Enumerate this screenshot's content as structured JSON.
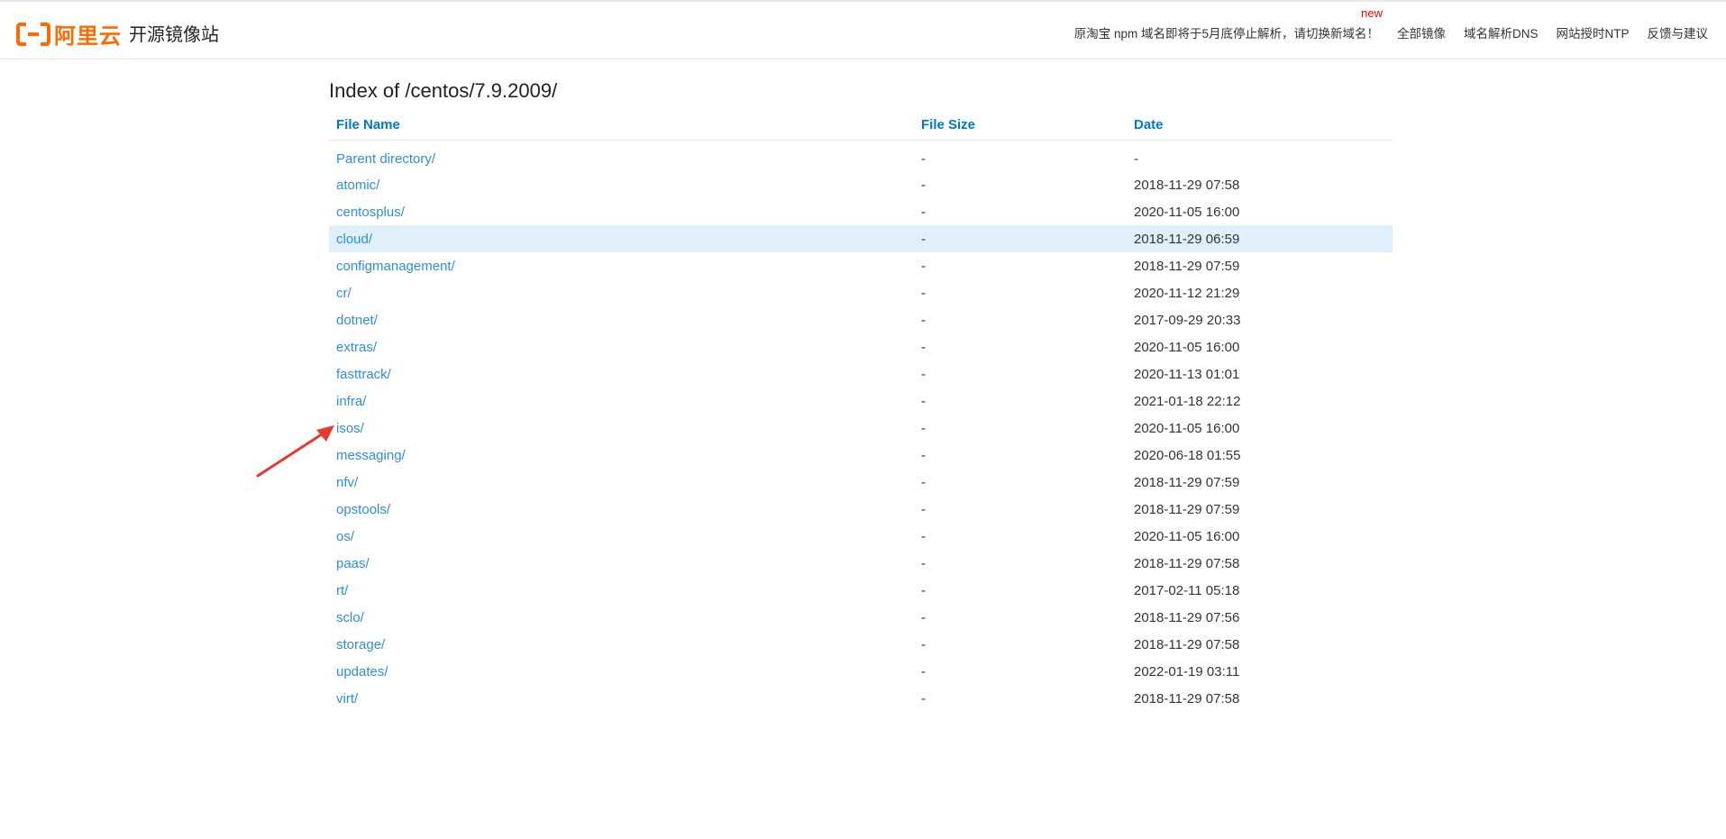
{
  "header": {
    "logo_text": "阿里云",
    "site_title": "开源镜像站",
    "notice": "原淘宝 npm 域名即将于5月底停止解析，请切换新域名！",
    "new_badge": "new",
    "nav": [
      "全部镜像",
      "域名解析DNS",
      "网站授时NTP",
      "反馈与建议"
    ],
    "brand_color": "#ff6a00"
  },
  "page_title": "Index of /centos/7.9.2009/",
  "table": {
    "columns": [
      "File Name",
      "File Size",
      "Date"
    ],
    "rows": [
      {
        "name": "Parent directory/",
        "size": "-",
        "date": "-"
      },
      {
        "name": "atomic/",
        "size": "-",
        "date": "2018-11-29 07:58"
      },
      {
        "name": "centosplus/",
        "size": "-",
        "date": "2020-11-05 16:00"
      },
      {
        "name": "cloud/",
        "size": "-",
        "date": "2018-11-29 06:59"
      },
      {
        "name": "configmanagement/",
        "size": "-",
        "date": "2018-11-29 07:59"
      },
      {
        "name": "cr/",
        "size": "-",
        "date": "2020-11-12 21:29"
      },
      {
        "name": "dotnet/",
        "size": "-",
        "date": "2017-09-29 20:33"
      },
      {
        "name": "extras/",
        "size": "-",
        "date": "2020-11-05 16:00"
      },
      {
        "name": "fasttrack/",
        "size": "-",
        "date": "2020-11-13 01:01"
      },
      {
        "name": "infra/",
        "size": "-",
        "date": "2021-01-18 22:12"
      },
      {
        "name": "isos/",
        "size": "-",
        "date": "2020-11-05 16:00"
      },
      {
        "name": "messaging/",
        "size": "-",
        "date": "2020-06-18 01:55"
      },
      {
        "name": "nfv/",
        "size": "-",
        "date": "2018-11-29 07:59"
      },
      {
        "name": "opstools/",
        "size": "-",
        "date": "2018-11-29 07:59"
      },
      {
        "name": "os/",
        "size": "-",
        "date": "2020-11-05 16:00"
      },
      {
        "name": "paas/",
        "size": "-",
        "date": "2018-11-29 07:58"
      },
      {
        "name": "rt/",
        "size": "-",
        "date": "2017-02-11 05:18"
      },
      {
        "name": "sclo/",
        "size": "-",
        "date": "2018-11-29 07:56"
      },
      {
        "name": "storage/",
        "size": "-",
        "date": "2018-11-29 07:58"
      },
      {
        "name": "updates/",
        "size": "-",
        "date": "2022-01-19 03:11"
      },
      {
        "name": "virt/",
        "size": "-",
        "date": "2018-11-29 07:58"
      }
    ],
    "highlighted_row": "cloud/",
    "link_color": "#2e8ed8",
    "highlight_color": "#dff0fa"
  },
  "annotation": {
    "arrow_icon": "red-arrow-icon",
    "points_to": "isos/",
    "color": "#e8392e"
  }
}
